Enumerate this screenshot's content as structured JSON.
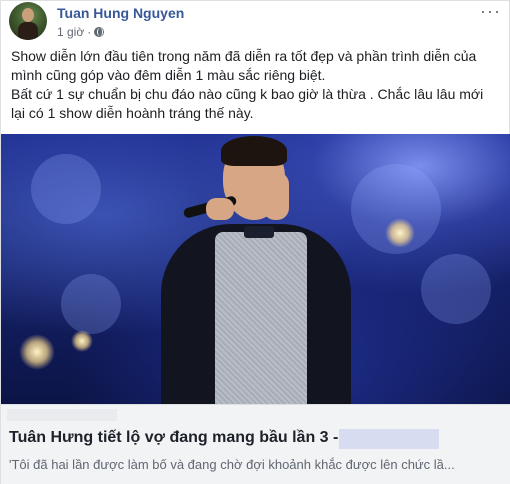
{
  "post": {
    "author": "Tuan Hung Nguyen",
    "time": "1 giờ",
    "separator": "·",
    "more_label": "···",
    "text_lines": [
      "Show diễn lớn đầu tiên trong năm đã diễn ra tốt đẹp và phần trình diễn của",
      "mình cũng góp vào đêm diễn 1 màu sắc riêng biệt.",
      "Bất cứ 1 sự chuẩn bị chu đáo nào cũng k bao giờ là thừa . Chắc lâu lâu mới",
      "lại có 1 show diễn hoành tráng thế này."
    ]
  },
  "link_preview": {
    "title": "Tuân Hưng tiết lộ vợ đang mang bầu lần 3 -",
    "description": "'Tôi đã hai lần được làm bố và đang chờ đợi khoảnh khắc được lên chức lầ..."
  },
  "colors": {
    "author": "#385898",
    "stage_blue": "#1b2a8a",
    "preview_bg": "#f2f3f5"
  }
}
